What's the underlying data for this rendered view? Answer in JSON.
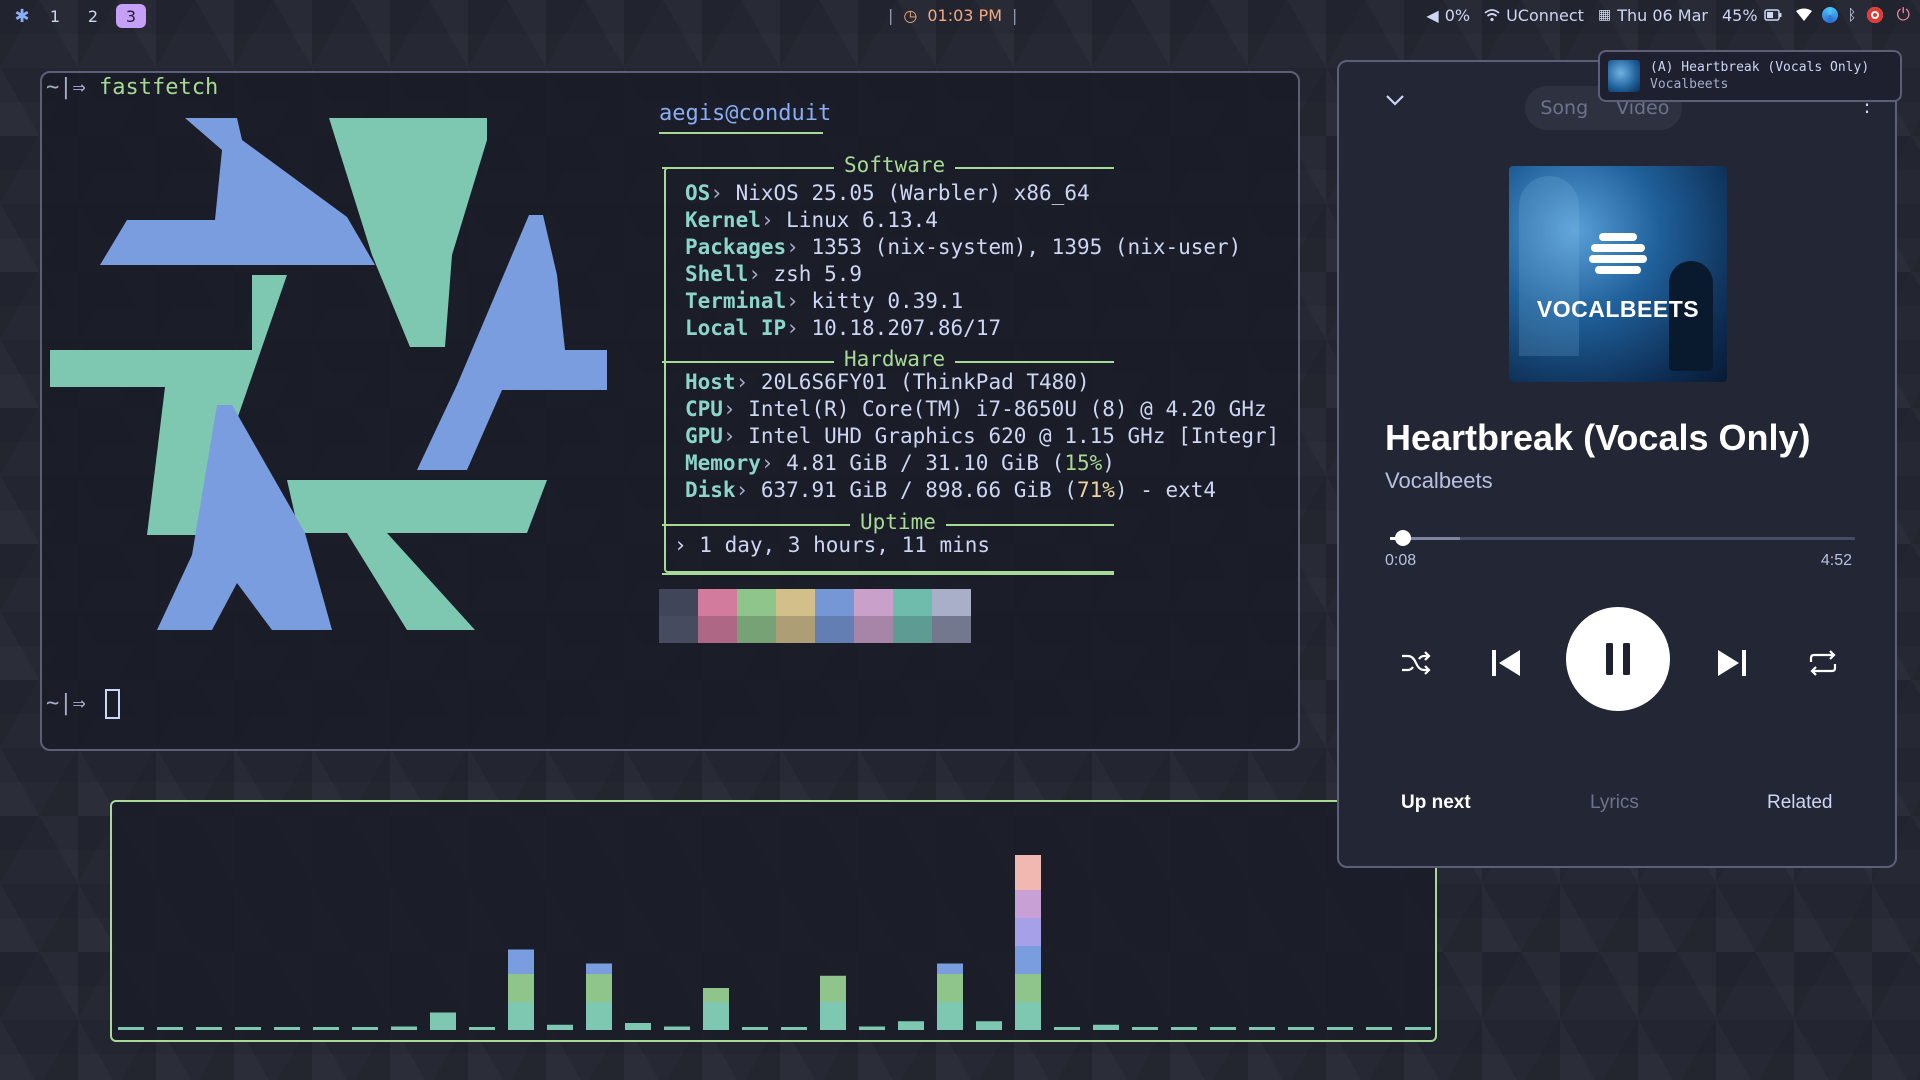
{
  "topbar": {
    "workspaces": [
      "1",
      "2",
      "3"
    ],
    "active_workspace": "3",
    "clock": "01:03 PM",
    "volume": "0%",
    "wifi": "UConnect",
    "date": "Thu 06 Mar",
    "battery": "45%",
    "tray_icons": [
      "wifi-icon",
      "browser-icon",
      "bluetooth-icon",
      "record-icon"
    ],
    "colors": {
      "accent": "#c6a0f6",
      "clock": "#f5a97f",
      "power": "#ed8796"
    }
  },
  "terminal": {
    "prompt_symbol": "~|⇒",
    "command": "fastfetch",
    "userhost": "aegis@conduit",
    "sections": {
      "software": "Software",
      "hardware": "Hardware",
      "uptime": "Uptime"
    },
    "info": {
      "os_key": "OS",
      "os_val": " NixOS 25.05 (Warbler) x86_64",
      "kernel_key": "Kernel",
      "kernel_val": " Linux 6.13.4",
      "packages_key": "Packages",
      "packages_val": " 1353 (nix-system), 1395 (nix-user)",
      "shell_key": "Shell",
      "shell_val": " zsh 5.9",
      "terminal_key": "Terminal",
      "terminal_val": " kitty 0.39.1",
      "localip_key": "Local IP",
      "localip_val": " 10.18.207.86/17",
      "host_key": "Host",
      "host_val": " 20L6S6FY01 (ThinkPad T480)",
      "cpu_key": "CPU",
      "cpu_val": " Intel(R) Core(TM) i7-8650U (8) @ 4.20 GHz",
      "gpu_key": "GPU",
      "gpu_val": " Intel UHD Graphics 620 @ 1.15 GHz [Integr]",
      "memory_key": "Memory",
      "memory_val": " 4.81 GiB / 31.10 GiB (",
      "memory_pct": "15%",
      "memory_end": ")",
      "disk_key": "Disk",
      "disk_val": " 637.91 GiB / 898.66 GiB (",
      "disk_pct": "71%",
      "disk_end": ") - ext4",
      "uptime_val": "› 1 day, 3 hours, 11 mins",
      "sep": "›"
    },
    "palette_top": [
      "#414559",
      "#d37b9c",
      "#8fc48a",
      "#d2bf8a",
      "#7597d6",
      "#c9a0c9",
      "#6fbcad",
      "#a9afc8"
    ],
    "palette_bottom": [
      "#51576d",
      "#d37b9c",
      "#8fc48a",
      "#d2bf8a",
      "#7597d6",
      "#c9a0c9",
      "#6fbcad",
      "#8b90a8"
    ],
    "logo_colors": {
      "blue": "#7a9de0",
      "teal": "#7ec8b1"
    }
  },
  "visualizer": {
    "levels": [
      0.0,
      0.0,
      0.0,
      0.0,
      0.0,
      0.0,
      0.01,
      0.02,
      0.1,
      0.0,
      0.46,
      0.03,
      0.38,
      0.04,
      0.02,
      0.24,
      0.0,
      0.0,
      0.31,
      0.02,
      0.05,
      0.38,
      0.05,
      1.0,
      0.0,
      0.03,
      0.0,
      0.0,
      0.0,
      0.0,
      0.0,
      0.0,
      0.0,
      0.0
    ],
    "colors": [
      "#7ec8b1",
      "#8fc48a",
      "#7a9de0",
      "#a6a0e8",
      "#c9a0d6",
      "#f0b8b0"
    ]
  },
  "notification": {
    "title": "(A) Heartbreak (Vocals Only)",
    "subtitle": "Vocalbeets"
  },
  "player": {
    "tab_song": "Song",
    "tab_video": "Video",
    "album_text": "VOCALBEETS",
    "title": "Heartbreak (Vocals Only)",
    "artist": "Vocalbeets",
    "elapsed": "0:08",
    "duration": "4:52",
    "progress": 0.028,
    "buffered": 0.15,
    "bottom_tabs": {
      "up_next": "Up next",
      "lyrics": "Lyrics",
      "related": "Related"
    }
  }
}
